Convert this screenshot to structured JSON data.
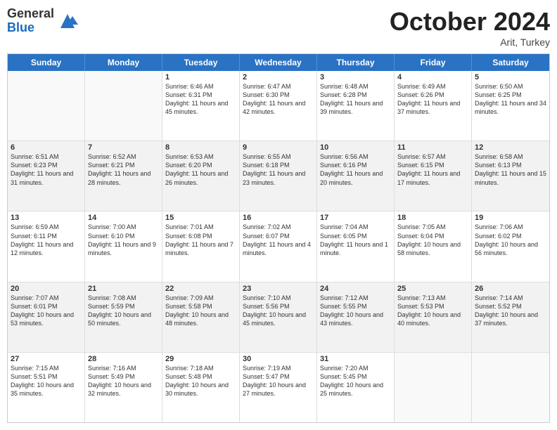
{
  "logo": {
    "line1": "General",
    "line2": "Blue"
  },
  "header": {
    "month": "October 2024",
    "location": "Arit, Turkey"
  },
  "weekdays": [
    "Sunday",
    "Monday",
    "Tuesday",
    "Wednesday",
    "Thursday",
    "Friday",
    "Saturday"
  ],
  "rows": [
    [
      {
        "day": "",
        "sunrise": "",
        "sunset": "",
        "daylight": "",
        "empty": true
      },
      {
        "day": "",
        "sunrise": "",
        "sunset": "",
        "daylight": "",
        "empty": true
      },
      {
        "day": "1",
        "sunrise": "Sunrise: 6:46 AM",
        "sunset": "Sunset: 6:31 PM",
        "daylight": "Daylight: 11 hours and 45 minutes."
      },
      {
        "day": "2",
        "sunrise": "Sunrise: 6:47 AM",
        "sunset": "Sunset: 6:30 PM",
        "daylight": "Daylight: 11 hours and 42 minutes."
      },
      {
        "day": "3",
        "sunrise": "Sunrise: 6:48 AM",
        "sunset": "Sunset: 6:28 PM",
        "daylight": "Daylight: 11 hours and 39 minutes."
      },
      {
        "day": "4",
        "sunrise": "Sunrise: 6:49 AM",
        "sunset": "Sunset: 6:26 PM",
        "daylight": "Daylight: 11 hours and 37 minutes."
      },
      {
        "day": "5",
        "sunrise": "Sunrise: 6:50 AM",
        "sunset": "Sunset: 6:25 PM",
        "daylight": "Daylight: 11 hours and 34 minutes."
      }
    ],
    [
      {
        "day": "6",
        "sunrise": "Sunrise: 6:51 AM",
        "sunset": "Sunset: 6:23 PM",
        "daylight": "Daylight: 11 hours and 31 minutes."
      },
      {
        "day": "7",
        "sunrise": "Sunrise: 6:52 AM",
        "sunset": "Sunset: 6:21 PM",
        "daylight": "Daylight: 11 hours and 28 minutes."
      },
      {
        "day": "8",
        "sunrise": "Sunrise: 6:53 AM",
        "sunset": "Sunset: 6:20 PM",
        "daylight": "Daylight: 11 hours and 26 minutes."
      },
      {
        "day": "9",
        "sunrise": "Sunrise: 6:55 AM",
        "sunset": "Sunset: 6:18 PM",
        "daylight": "Daylight: 11 hours and 23 minutes."
      },
      {
        "day": "10",
        "sunrise": "Sunrise: 6:56 AM",
        "sunset": "Sunset: 6:16 PM",
        "daylight": "Daylight: 11 hours and 20 minutes."
      },
      {
        "day": "11",
        "sunrise": "Sunrise: 6:57 AM",
        "sunset": "Sunset: 6:15 PM",
        "daylight": "Daylight: 11 hours and 17 minutes."
      },
      {
        "day": "12",
        "sunrise": "Sunrise: 6:58 AM",
        "sunset": "Sunset: 6:13 PM",
        "daylight": "Daylight: 11 hours and 15 minutes."
      }
    ],
    [
      {
        "day": "13",
        "sunrise": "Sunrise: 6:59 AM",
        "sunset": "Sunset: 6:11 PM",
        "daylight": "Daylight: 11 hours and 12 minutes."
      },
      {
        "day": "14",
        "sunrise": "Sunrise: 7:00 AM",
        "sunset": "Sunset: 6:10 PM",
        "daylight": "Daylight: 11 hours and 9 minutes."
      },
      {
        "day": "15",
        "sunrise": "Sunrise: 7:01 AM",
        "sunset": "Sunset: 6:08 PM",
        "daylight": "Daylight: 11 hours and 7 minutes."
      },
      {
        "day": "16",
        "sunrise": "Sunrise: 7:02 AM",
        "sunset": "Sunset: 6:07 PM",
        "daylight": "Daylight: 11 hours and 4 minutes."
      },
      {
        "day": "17",
        "sunrise": "Sunrise: 7:04 AM",
        "sunset": "Sunset: 6:05 PM",
        "daylight": "Daylight: 11 hours and 1 minute."
      },
      {
        "day": "18",
        "sunrise": "Sunrise: 7:05 AM",
        "sunset": "Sunset: 6:04 PM",
        "daylight": "Daylight: 10 hours and 58 minutes."
      },
      {
        "day": "19",
        "sunrise": "Sunrise: 7:06 AM",
        "sunset": "Sunset: 6:02 PM",
        "daylight": "Daylight: 10 hours and 56 minutes."
      }
    ],
    [
      {
        "day": "20",
        "sunrise": "Sunrise: 7:07 AM",
        "sunset": "Sunset: 6:01 PM",
        "daylight": "Daylight: 10 hours and 53 minutes."
      },
      {
        "day": "21",
        "sunrise": "Sunrise: 7:08 AM",
        "sunset": "Sunset: 5:59 PM",
        "daylight": "Daylight: 10 hours and 50 minutes."
      },
      {
        "day": "22",
        "sunrise": "Sunrise: 7:09 AM",
        "sunset": "Sunset: 5:58 PM",
        "daylight": "Daylight: 10 hours and 48 minutes."
      },
      {
        "day": "23",
        "sunrise": "Sunrise: 7:10 AM",
        "sunset": "Sunset: 5:56 PM",
        "daylight": "Daylight: 10 hours and 45 minutes."
      },
      {
        "day": "24",
        "sunrise": "Sunrise: 7:12 AM",
        "sunset": "Sunset: 5:55 PM",
        "daylight": "Daylight: 10 hours and 43 minutes."
      },
      {
        "day": "25",
        "sunrise": "Sunrise: 7:13 AM",
        "sunset": "Sunset: 5:53 PM",
        "daylight": "Daylight: 10 hours and 40 minutes."
      },
      {
        "day": "26",
        "sunrise": "Sunrise: 7:14 AM",
        "sunset": "Sunset: 5:52 PM",
        "daylight": "Daylight: 10 hours and 37 minutes."
      }
    ],
    [
      {
        "day": "27",
        "sunrise": "Sunrise: 7:15 AM",
        "sunset": "Sunset: 5:51 PM",
        "daylight": "Daylight: 10 hours and 35 minutes."
      },
      {
        "day": "28",
        "sunrise": "Sunrise: 7:16 AM",
        "sunset": "Sunset: 5:49 PM",
        "daylight": "Daylight: 10 hours and 32 minutes."
      },
      {
        "day": "29",
        "sunrise": "Sunrise: 7:18 AM",
        "sunset": "Sunset: 5:48 PM",
        "daylight": "Daylight: 10 hours and 30 minutes."
      },
      {
        "day": "30",
        "sunrise": "Sunrise: 7:19 AM",
        "sunset": "Sunset: 5:47 PM",
        "daylight": "Daylight: 10 hours and 27 minutes."
      },
      {
        "day": "31",
        "sunrise": "Sunrise: 7:20 AM",
        "sunset": "Sunset: 5:45 PM",
        "daylight": "Daylight: 10 hours and 25 minutes."
      },
      {
        "day": "",
        "sunrise": "",
        "sunset": "",
        "daylight": "",
        "empty": true
      },
      {
        "day": "",
        "sunrise": "",
        "sunset": "",
        "daylight": "",
        "empty": true
      }
    ]
  ]
}
